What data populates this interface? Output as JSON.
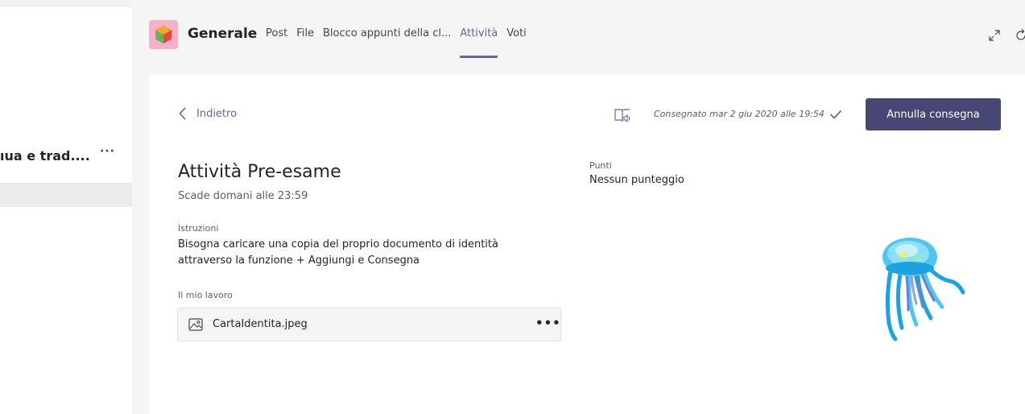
{
  "sidebar": {
    "team_name": "ıua e trad....",
    "more_label": "···"
  },
  "header": {
    "channel_title": "Generale",
    "tabs": [
      {
        "label": "Post"
      },
      {
        "label": "File"
      },
      {
        "label": "Blocco appunti della cl..."
      },
      {
        "label": "Attività"
      },
      {
        "label": "Voti"
      }
    ],
    "active_tab": "Attività",
    "accent_color": "#6264a7"
  },
  "assignment": {
    "back_label": "Indietro",
    "status": "Consegnato mar 2 giu 2020 alle 19:54",
    "undo_button_label": "Annulla consegna",
    "title": "Attività Pre-esame",
    "due": "Scade domani alle 23:59",
    "instructions_label": "Istruzioni",
    "instructions_text": "Bisogna caricare una copia del proprio documento di identità attraverso la funzione + Aggiungi e Consegna",
    "my_work_label": "Il mio lavoro",
    "file_name": "CartaIdentita.jpeg",
    "file_more": "•••",
    "points_label": "Punti",
    "points_value": "Nessun punteggio",
    "button_color": "#464775"
  },
  "icons": [
    "chevron-left-icon",
    "immersive-reader-icon",
    "checkmark-icon",
    "image-file-icon",
    "expand-icon",
    "refresh-icon",
    "jellyfish-illustration"
  ]
}
